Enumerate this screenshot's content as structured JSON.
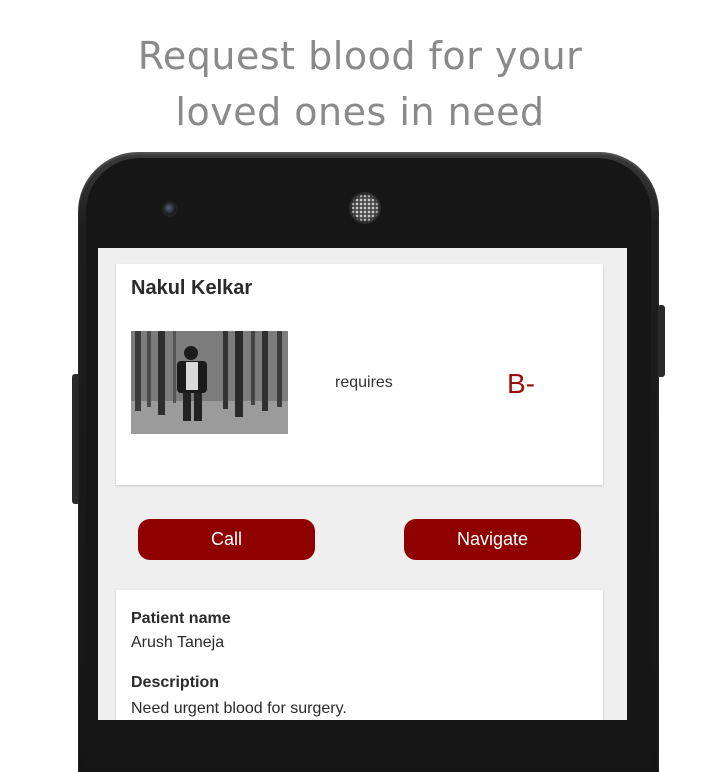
{
  "promo": {
    "line1": "Request blood for your",
    "line2": "loved ones in need"
  },
  "request": {
    "donor_name": "Nakul Kelkar",
    "requires_label": "requires",
    "blood_group": "B-"
  },
  "actions": {
    "call_label": "Call",
    "navigate_label": "Navigate"
  },
  "details": {
    "patient_name_label": "Patient name",
    "patient_name": "Arush Taneja",
    "description_label": "Description",
    "description": "Need urgent blood for surgery."
  },
  "colors": {
    "accent": "#8f0000",
    "blood_group_text": "#9b0e0e",
    "headline_text": "#8a8a8a",
    "screen_background": "#efefef"
  },
  "icons": [
    "front-camera-icon",
    "speaker-grille-icon"
  ]
}
